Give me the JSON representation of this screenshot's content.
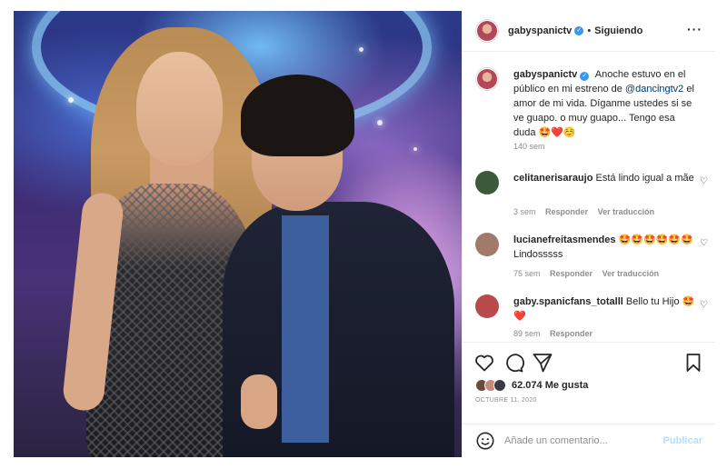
{
  "post": {
    "username": "gabyspanictv",
    "separator": "•",
    "follow_status": "Siguiendo",
    "more_label": "···"
  },
  "caption": {
    "username": "gabyspanictv",
    "text_before": "Anoche estuvo en el público en mi estreno de ",
    "mention": "@dancingtv2",
    "text_after": " el amor de mi vida. Díganme ustedes si se ve guapo. o muy guapo... Tengo esa duda 🤩❤️☺️",
    "time": "140 sem"
  },
  "comments": [
    {
      "username": "celitanerisaraujo",
      "text": "Está lindo igual a mãe",
      "time": "3 sem",
      "reply": "Responder",
      "translate": "Ver traducción",
      "avatar_color": "#3c5a3a"
    },
    {
      "username": "lucianefreitasmendes",
      "text": "🤩🤩🤩🤩🤩🤩Lindosssss",
      "time": "75 sem",
      "reply": "Responder",
      "translate": "Ver traducción",
      "avatar_color": "#a27a6a"
    },
    {
      "username": "gaby.spanicfans_totalll",
      "text": "Bello tu Hijo 🤩❤️",
      "time": "89 sem",
      "reply": "Responder",
      "translate": "",
      "avatar_color": "#b84a4a"
    }
  ],
  "likes": {
    "count_text": "62.074 Me gusta"
  },
  "date": "OCTUBRE 11, 2020",
  "composer": {
    "placeholder": "Añade un comentario...",
    "publish": "Publicar"
  },
  "colors": {
    "accent": "#0095f6",
    "publish_disabled": "#b2dffc",
    "verified": "#3897f0",
    "muted": "#8e8e8e"
  }
}
